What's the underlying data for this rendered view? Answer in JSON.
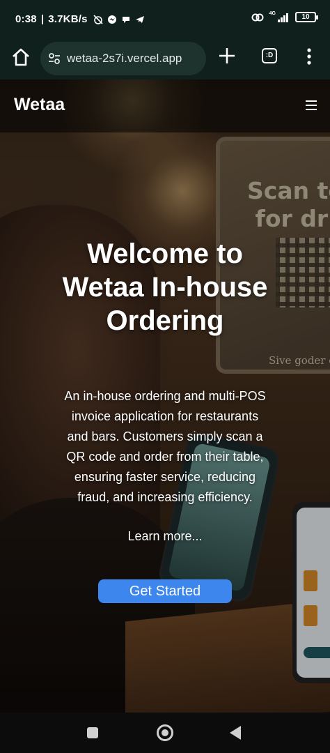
{
  "status_bar": {
    "time": "0:38",
    "speed": "3.7KB/s",
    "network": "4G",
    "battery": "10"
  },
  "browser": {
    "url": "wetaa-2s7i.vercel.app",
    "tabs_label": ":D"
  },
  "site": {
    "brand": "Wetaa",
    "hero": {
      "title": "Welcome to Wetaa In-house Ordering",
      "description": "An in-house ordering and multi-POS invoice application for restaurants and bars. Customers simply scan a QR code and order from their table, ensuring faster service, reducing fraud, and increasing efficiency.",
      "learn_more": "Learn more...",
      "cta": "Get Started"
    },
    "background_sign": {
      "text_line1": "Scan to",
      "text_line2": "for dri",
      "subtext": "Sive goder of"
    }
  },
  "colors": {
    "cta": "#3d86ee",
    "chrome": "#10201c"
  }
}
